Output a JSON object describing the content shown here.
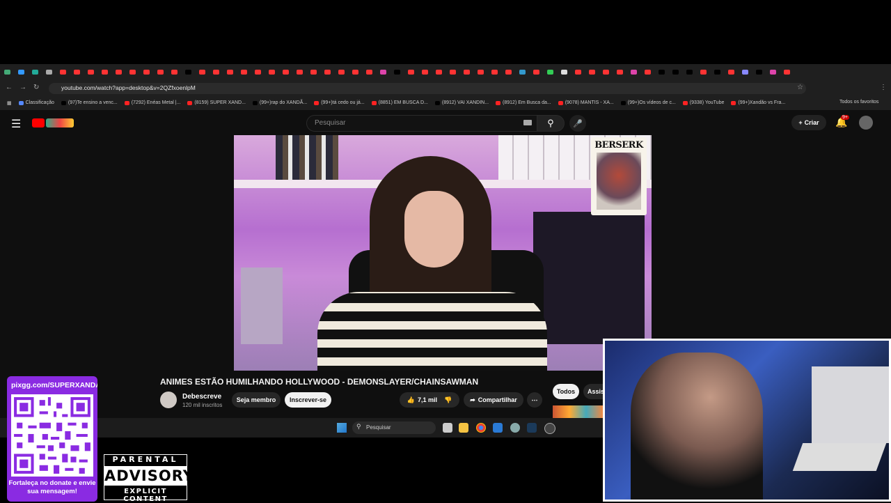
{
  "browser": {
    "url": "youtube.com/watch?app=desktop&v=2QZfxoenlpM",
    "bookmarks": [
      "Classificação",
      "(97)Te ensino a venc...",
      "(7292) Enéas Metal |...",
      "(8159) SUPER XAND...",
      "(99+)rap do XANDÃ...",
      "(99+)tá cedo ou já...",
      "(8851) EM BUSCA D...",
      "(8912) VAI XANDIN...",
      "(8912) Em Busca da...",
      "(9078) MANTIS - XA...",
      "(99+)Os vídeos de c...",
      "(9338) YouTube",
      "(99+)Xandão vs Fra..."
    ],
    "all_bookmarks": "Todos os favoritos"
  },
  "youtube": {
    "search_placeholder": "Pesquisar",
    "create_label": "Criar",
    "notifications_badge": "9+",
    "video_overlay_text": "BERSERK",
    "video_title": "ANIMES ESTÃO HUMILHANDO HOLLYWOOD - DEMONSLAYER/CHAINSAWMAN",
    "channel_name": "Debescreve",
    "subscribers": "120 mil inscritos",
    "member_label": "Seja membro",
    "subscribe_label": "Inscrever-se",
    "likes": "7,1 mil",
    "share_label": "Compartilhar",
    "chips": [
      "Todos",
      "Assis"
    ]
  },
  "taskbar": {
    "search_placeholder": "Pesquisar"
  },
  "overlay": {
    "donate_url": "pixgg.com/SUPERXANDA",
    "donate_message": "Fortaleça no donate e envie sua mensagem!",
    "advisory_line1": "PARENTAL",
    "advisory_line2": "ADVISORY",
    "advisory_line3": "EXPLICIT CONTENT"
  },
  "colors": {
    "youtube_red": "#ff0000",
    "donate_purple": "#8a2be2",
    "bg": "#0f0f0f"
  }
}
